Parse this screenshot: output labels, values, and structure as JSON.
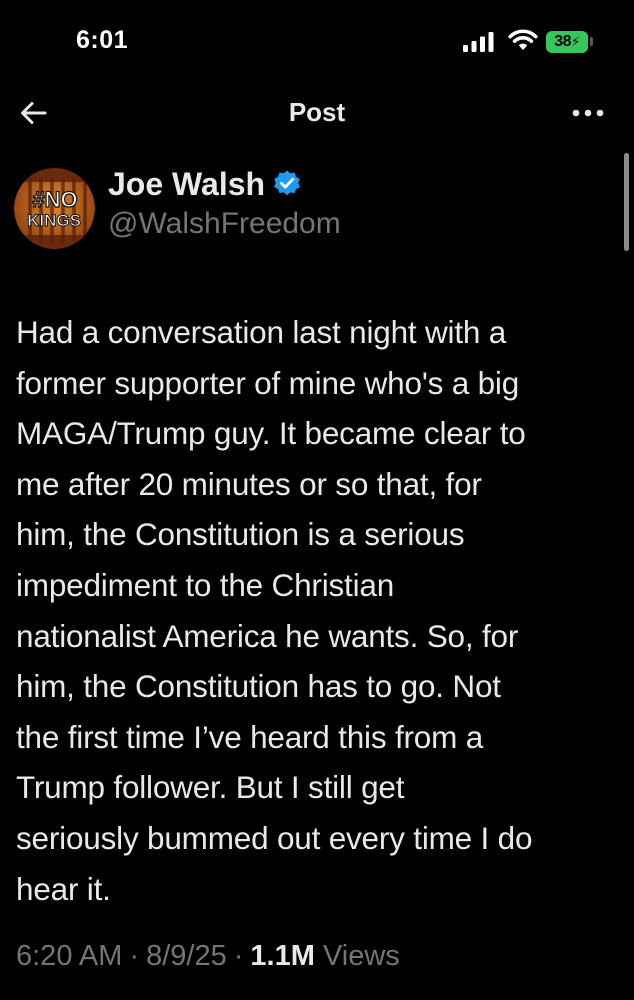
{
  "status_bar": {
    "time": "6:01",
    "battery_level": "38",
    "icons": [
      "cellular-signal-icon",
      "wifi-icon",
      "battery-charging-icon"
    ],
    "battery_color": "#34c759"
  },
  "nav": {
    "title": "Post",
    "back_icon": "arrow-left-icon",
    "more_icon": "more-horizontal-icon"
  },
  "author": {
    "name": "Joe Walsh",
    "handle": "@WalshFreedom",
    "verified": true,
    "verified_color": "#1d9bf0",
    "avatar_text_top": "#NO",
    "avatar_text_bottom": "KINGS"
  },
  "tweet": {
    "lines": [
      "Had a conversation last night with a",
      "former supporter of mine who's a big",
      "MAGA/Trump guy. It became clear to",
      "me after 20 minutes or so that, for",
      "him, the Constitution is a serious",
      "impediment to the Christian",
      "nationalist America he wants. So, for",
      "him, the Constitution has to go. Not",
      "the first time I’ve heard this from a",
      "Trump follower. But I still get",
      "seriously bummed out every time I do",
      "hear it."
    ]
  },
  "meta": {
    "time": "6:20 AM",
    "date": "8/9/25",
    "views_count": "1.1M",
    "views_label": "Views",
    "separator": "·"
  }
}
